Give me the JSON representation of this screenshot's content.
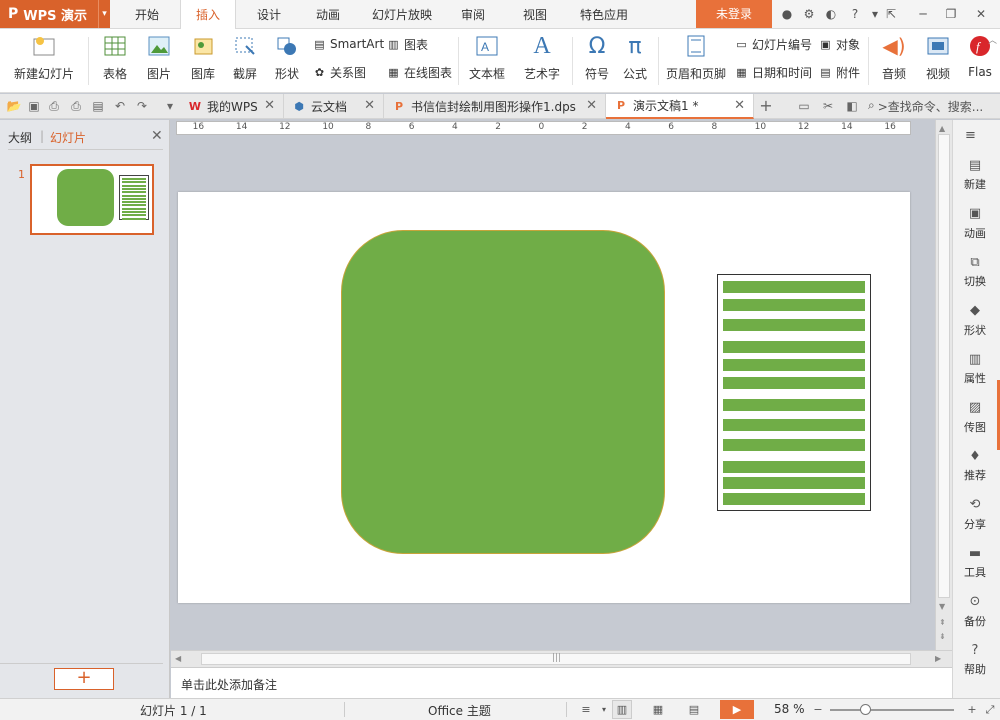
{
  "app": {
    "logo": "P",
    "name": "WPS 演示",
    "menu_tabs": [
      {
        "label": "开始",
        "active": false
      },
      {
        "label": "插入",
        "active": true
      },
      {
        "label": "设计",
        "active": false
      },
      {
        "label": "动画",
        "active": false
      },
      {
        "label": "幻灯片放映",
        "active": false
      },
      {
        "label": "审阅",
        "active": false
      },
      {
        "label": "视图",
        "active": false
      },
      {
        "label": "特色应用",
        "active": false
      }
    ],
    "login_label": "未登录",
    "accent_color": "#d9622b"
  },
  "ribbon": {
    "new_slide": "新建幻灯片",
    "table": "表格",
    "picture": "图片",
    "gallery": "图库",
    "screenshot": "截屏",
    "shapes": "形状",
    "smartart": "SmartArt",
    "chart": "图表",
    "relation": "关系图",
    "online_chart": "在线图表",
    "textbox": "文本框",
    "wordart": "艺术字",
    "symbol": "符号",
    "formula": "公式",
    "header_footer": "页眉和页脚",
    "slide_number": "幻灯片编号",
    "object": "对象",
    "datetime": "日期和时间",
    "attachment": "附件",
    "audio": "音频",
    "video": "视频",
    "flash": "Flas"
  },
  "doc_tabs": [
    {
      "label": "我的WPS",
      "icon": "W",
      "active": false
    },
    {
      "label": "云文档",
      "icon": "cloud-doc",
      "active": false
    },
    {
      "label": "书信信封绘制用图形操作1.dps",
      "icon": "P",
      "active": false
    },
    {
      "label": "演示文稿1 *",
      "icon": "P",
      "active": true
    }
  ],
  "search": {
    "placeholder": ">查找命令、搜索..."
  },
  "left_panel": {
    "tab_outline": "大纲",
    "tab_slides": "幻灯片",
    "slide_number": "1",
    "add_label": "+"
  },
  "ruler": {
    "labels": [
      "16",
      "14",
      "12",
      "10",
      "8",
      "6",
      "4",
      "2",
      "0",
      "2",
      "4",
      "6",
      "8",
      "10",
      "12",
      "14",
      "16"
    ]
  },
  "slide": {
    "shape_color": "#70ad47",
    "stripe_count": 13
  },
  "notes": {
    "placeholder": "单击此处添加备注"
  },
  "right_sidebar": [
    {
      "label": "新建",
      "icon": "new-icon"
    },
    {
      "label": "动画",
      "icon": "animation-icon"
    },
    {
      "label": "切换",
      "icon": "transition-icon"
    },
    {
      "label": "形状",
      "icon": "shape-icon"
    },
    {
      "label": "属性",
      "icon": "property-icon"
    },
    {
      "label": "传图",
      "icon": "upload-image-icon"
    },
    {
      "label": "推荐",
      "icon": "recommend-icon"
    },
    {
      "label": "分享",
      "icon": "share-icon"
    },
    {
      "label": "工具",
      "icon": "tools-icon"
    },
    {
      "label": "备份",
      "icon": "backup-icon"
    },
    {
      "label": "帮助",
      "icon": "help-icon"
    }
  ],
  "status": {
    "slide_info": "幻灯片 1 / 1",
    "theme": "Office 主题",
    "zoom": "58 %"
  }
}
